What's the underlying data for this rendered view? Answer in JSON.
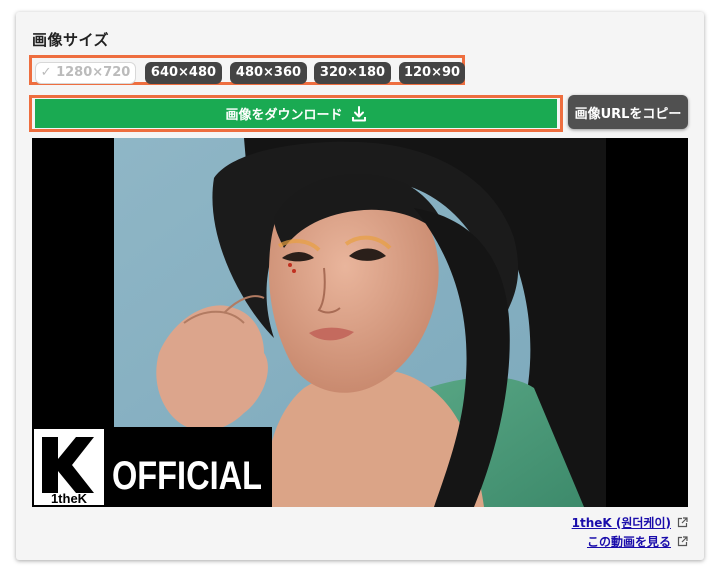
{
  "section": {
    "title": "画像サイズ"
  },
  "sizes": [
    {
      "label": "✓ 1280×720",
      "selected": true
    },
    {
      "label": "640×480",
      "selected": false
    },
    {
      "label": "480×360",
      "selected": false
    },
    {
      "label": "320×180",
      "selected": false
    },
    {
      "label": "120×90",
      "selected": false
    }
  ],
  "actions": {
    "download_label": "画像をダウンロード",
    "copy_url_label": "画像URLをコピー"
  },
  "thumbnail": {
    "logo_brand": "1theK",
    "logo_text": "OFFICIAL"
  },
  "links": {
    "channel_label": "1theK (원더케이)",
    "video_label": "この動画を見る"
  },
  "colors": {
    "highlight": "#ee6e3f",
    "download": "#1aaa52",
    "dark_button": "#444444",
    "link": "#1a0dab"
  }
}
